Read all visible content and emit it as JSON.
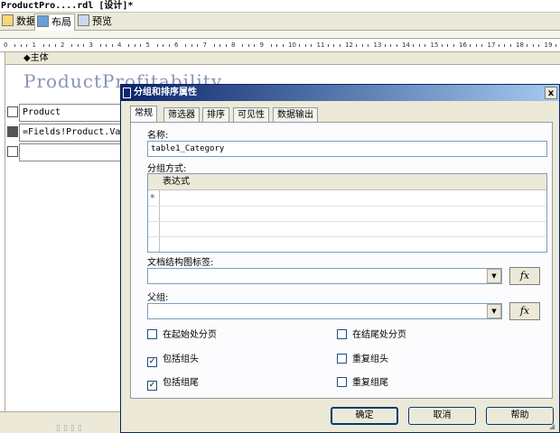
{
  "document": {
    "title": "ProductPro....rdl [设计]*"
  },
  "designer_tabs": [
    {
      "label": "数据"
    },
    {
      "label": "布局"
    },
    {
      "label": "预览"
    }
  ],
  "ruler": {
    "marks": [
      "0",
      "1",
      "2",
      "3",
      "4",
      "5",
      "6",
      "7",
      "8",
      "9",
      "10",
      "11",
      "12",
      "13",
      "14",
      "15",
      "16",
      "17",
      "18",
      "19"
    ]
  },
  "body_section": {
    "label": "◆主体"
  },
  "report": {
    "title_text": "ProductProfitability",
    "cells": [
      "Product",
      "=Fields!Product.Val",
      ""
    ]
  },
  "dialog": {
    "title": "分组和排序属性",
    "close_glyph": "x",
    "tabs": [
      {
        "label": "常规",
        "active": true
      },
      {
        "label": "筛选器"
      },
      {
        "label": "排序"
      },
      {
        "label": "可见性"
      },
      {
        "label": "数据输出"
      }
    ],
    "name_label": "名称:",
    "name_value": "table1_Category",
    "group_on_label": "分组方式:",
    "grid_header": "表达式",
    "grid_new_row_marker": "*",
    "doc_map_label": "文档结构图标签:",
    "doc_map_value": "",
    "parent_label": "父组:",
    "parent_value": "",
    "fx_label": "fx",
    "checkboxes": {
      "page_break_start": {
        "label": "在起始处分页",
        "checked": false
      },
      "page_break_end": {
        "label": "在结尾处分页",
        "checked": false
      },
      "include_header": {
        "label": "包括组头",
        "checked": true
      },
      "repeat_header": {
        "label": "重复组头",
        "checked": false
      },
      "include_footer": {
        "label": "包括组尾",
        "checked": true
      },
      "repeat_footer": {
        "label": "重复组尾",
        "checked": false
      }
    },
    "buttons": {
      "ok": "确定",
      "cancel": "取消",
      "help": "帮助"
    }
  },
  "colors": {
    "titlebar_start": "#0a246a",
    "titlebar_end": "#a6caf0",
    "face": "#ece9d8",
    "report_title": "#8a93b6"
  }
}
